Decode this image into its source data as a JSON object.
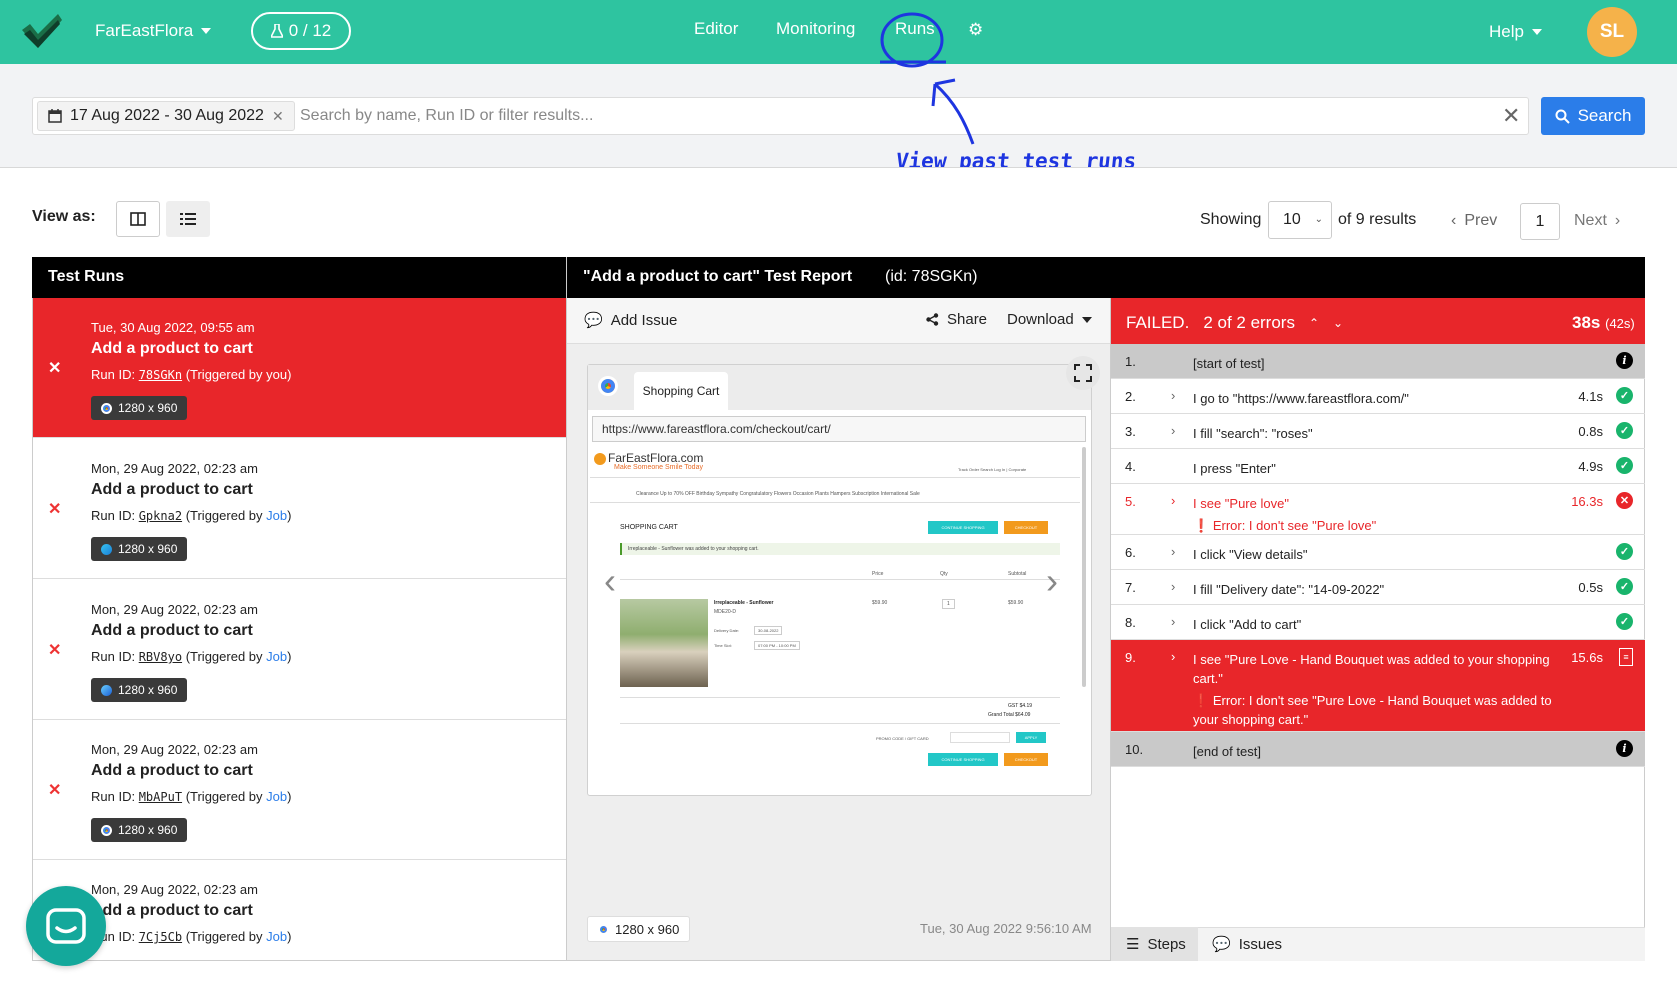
{
  "nav": {
    "project": "FarEastFlora",
    "counter": "0 / 12",
    "links": [
      "Editor",
      "Monitoring",
      "Runs"
    ],
    "help": "Help",
    "avatar": "SL"
  },
  "search": {
    "date_range": "17 Aug 2022 - 30 Aug 2022",
    "placeholder": "Search by name, Run ID or filter results...",
    "button": "Search"
  },
  "annotation": "View past test runs",
  "toolbar": {
    "view_as": "View as:",
    "showing": "Showing",
    "page_size": "10",
    "of_results": "of 9 results",
    "prev": "Prev",
    "page": "1",
    "next": "Next"
  },
  "runs_header": "Test Runs",
  "runs": [
    {
      "date": "Tue, 30 Aug 2022, 09:55 am",
      "title": "Add a product to cart",
      "id_label": "Run ID:",
      "run_id": "78SGKn",
      "trigger_pre": "(Triggered by ",
      "trigger": "you",
      "trigger_post": ")",
      "resolution": "1280 x 960",
      "browser": "chrome"
    },
    {
      "date": "Mon, 29 Aug 2022, 02:23 am",
      "title": "Add a product to cart",
      "id_label": "Run ID:",
      "run_id": "Gpkna2",
      "trigger_pre": "(Triggered by ",
      "trigger": "Job",
      "trigger_post": ")",
      "resolution": "1280 x 960",
      "browser": "edge"
    },
    {
      "date": "Mon, 29 Aug 2022, 02:23 am",
      "title": "Add a product to cart",
      "id_label": "Run ID:",
      "run_id": "RBV8yo",
      "trigger_pre": "(Triggered by ",
      "trigger": "Job",
      "trigger_post": ")",
      "resolution": "1280 x 960",
      "browser": "safari"
    },
    {
      "date": "Mon, 29 Aug 2022, 02:23 am",
      "title": "Add a product to cart",
      "id_label": "Run ID:",
      "run_id": "MbAPuT",
      "trigger_pre": "(Triggered by ",
      "trigger": "Job",
      "trigger_post": ")",
      "resolution": "1280 x 960",
      "browser": "chrome"
    },
    {
      "date": "Mon, 29 Aug 2022, 02:23 am",
      "title": "Add a product to cart",
      "id_label": "Run ID:",
      "run_id": "7Cj5Cb",
      "trigger_pre": "(Triggered by ",
      "trigger": "Job",
      "trigger_post": ")",
      "resolution": "",
      "browser": ""
    }
  ],
  "report": {
    "title": "\"Add a product to cart\" Test Report",
    "id": "(id: 78SGKn)",
    "add_issue": "Add Issue",
    "share": "Share",
    "download": "Download",
    "browser_tab": "Shopping Cart",
    "url": "https://www.fareastflora.com/checkout/cart/",
    "resolution": "1280 x 960",
    "timestamp": "Tue, 30 Aug 2022 9:56:10 AM"
  },
  "screenshot": {
    "brand": "FarEastFlora.com",
    "tagline": "Make Someone Smile Today",
    "top_links": "Track Order  Search  Log In | Corporate",
    "menu": "Clearance Up to 70% OFF  Birthday  Sympathy  Congratulatory  Flowers  Occasion  Plants  Hampers  Subscription  International  Sale",
    "heading": "SHOPPING CART",
    "continue": "CONTINUE SHOPPING",
    "checkout": "CHECKOUT",
    "notice": "Irreplaceable - Sunflower was added to your shopping cart.",
    "col_price": "Price",
    "col_qty": "Qty",
    "col_subtotal": "Subtotal",
    "product": "Irreplaceable - Sunflower",
    "sku": "MDE20-D",
    "delivery_label": "Delivery Date:",
    "delivery_value": "30-08-2022",
    "slot_label": "Time Slot:",
    "slot_value": "07:00 PM - 10:00 PM",
    "price": "$59.90",
    "qty": "1",
    "subtotal": "$59.90",
    "gst": "GST   $4.19",
    "grand_total": "Grand Total  $64.09",
    "promo": "PROMO CODE / GIFT CARD",
    "apply": "APPLY"
  },
  "result": {
    "status": "FAILED.",
    "errors": "2 of 2 errors",
    "duration": "38s",
    "total": "(42s)"
  },
  "steps": [
    {
      "n": "1.",
      "text": "[start of test]",
      "time": "",
      "status": "info",
      "expand": false,
      "style": "grey"
    },
    {
      "n": "2.",
      "text": "I go to \"https://www.fareastflora.com/\"",
      "time": "4.1s",
      "status": "ok",
      "expand": true,
      "style": ""
    },
    {
      "n": "3.",
      "text": "I fill \"search\": \"roses\"",
      "time": "0.8s",
      "status": "ok",
      "expand": true,
      "style": ""
    },
    {
      "n": "4.",
      "text": "I press \"Enter\"",
      "time": "4.9s",
      "status": "ok",
      "expand": false,
      "style": ""
    },
    {
      "n": "5.",
      "text": "I see \"Pure love\"",
      "time": "16.3s",
      "status": "err",
      "expand": true,
      "style": "errtext",
      "error": "Error: I don't see \"Pure love\""
    },
    {
      "n": "6.",
      "text": "I click \"View details\"",
      "time": "",
      "status": "ok",
      "expand": true,
      "style": ""
    },
    {
      "n": "7.",
      "text": "I fill \"Delivery date\": \"14-09-2022\"",
      "time": "0.5s",
      "status": "ok",
      "expand": true,
      "style": ""
    },
    {
      "n": "8.",
      "text": "I click \"Add to cart\"",
      "time": "",
      "status": "ok",
      "expand": true,
      "style": ""
    },
    {
      "n": "9.",
      "text": "I see \"Pure Love - Hand Bouquet was added to your shopping cart.\"",
      "time": "15.6s",
      "status": "doc",
      "expand": true,
      "style": "redbg",
      "error": "Error: I don't see \"Pure Love - Hand Bouquet was added to your shopping cart.\""
    },
    {
      "n": "10.",
      "text": "[end of test]",
      "time": "",
      "status": "info",
      "expand": false,
      "style": "grey"
    }
  ],
  "bottom_tabs": [
    "Steps",
    "Issues"
  ],
  "colors": {
    "brand": "#2ec4a0",
    "failed": "#e8262a",
    "ok": "#19b46c",
    "link": "#2b7de9"
  }
}
